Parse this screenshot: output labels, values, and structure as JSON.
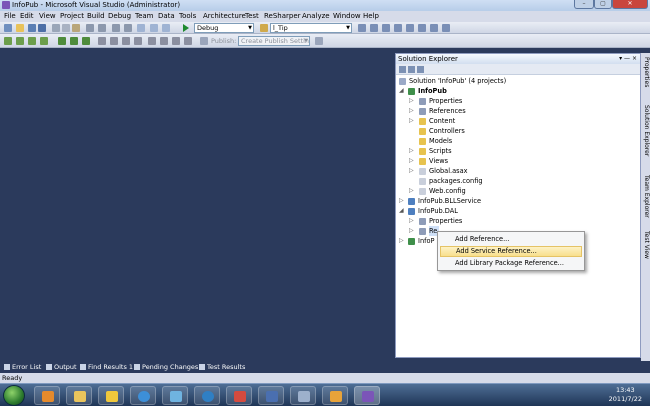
{
  "window": {
    "title": "InfoPub - Microsoft Visual Studio (Administrator)"
  },
  "menu": [
    "File",
    "Edit",
    "View",
    "Project",
    "Build",
    "Debug",
    "Team",
    "Data",
    "Tools",
    "Architecture",
    "Test",
    "ReSharper",
    "Analyze",
    "Window",
    "Help"
  ],
  "toolbar": {
    "config_value": "Debug",
    "find_value": "l_Tip",
    "publish_label": "Publish:",
    "publish_settings_value": "Create Publish Settings"
  },
  "solution_explorer": {
    "title": "Solution Explorer",
    "pin_buttons": "▾ — ×",
    "rows": [
      {
        "label": "Solution 'InfoPub' (4 projects)"
      },
      {
        "label": "InfoPub"
      },
      {
        "label": "Properties"
      },
      {
        "label": "References"
      },
      {
        "label": "Content"
      },
      {
        "label": "Controllers"
      },
      {
        "label": "Models"
      },
      {
        "label": "Scripts"
      },
      {
        "label": "Views"
      },
      {
        "label": "Global.asax"
      },
      {
        "label": "packages.config"
      },
      {
        "label": "Web.config"
      },
      {
        "label": "InfoPub.BLLService"
      },
      {
        "label": "InfoPub.DAL"
      },
      {
        "label": "Properties"
      },
      {
        "label": "Re"
      },
      {
        "label": "InfoP"
      }
    ]
  },
  "context_menu": {
    "items": [
      "Add Reference...",
      "Add Service Reference...",
      "Add Library Package Reference..."
    ]
  },
  "right_tabs": [
    "Properties",
    "Solution Explorer",
    "Team Explorer",
    "Test View"
  ],
  "bottom_tabs": [
    "Error List",
    "Output",
    "Find Results 1",
    "Pending Changes",
    "Test Results"
  ],
  "status": "Ready",
  "clock": {
    "time": "13:43",
    "date": "2011/7/22"
  },
  "colors": {
    "editor_bg": "#2b3a5c",
    "highlight": "#f8df8c"
  }
}
